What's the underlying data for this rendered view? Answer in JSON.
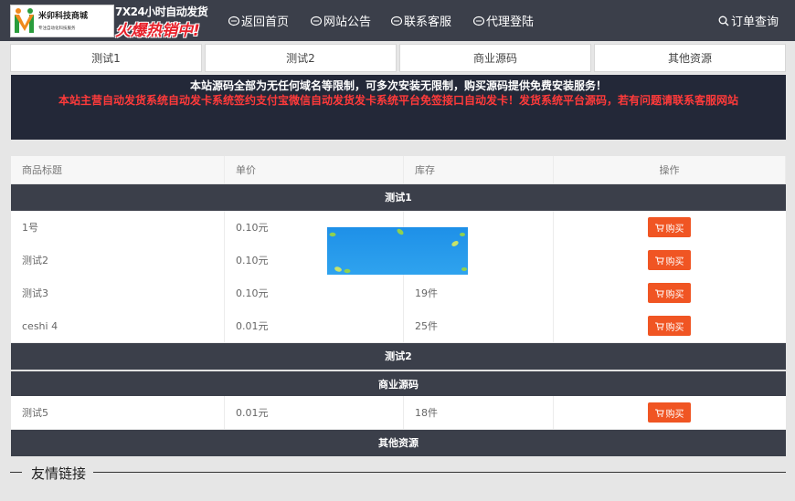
{
  "header": {
    "logo_name": "米卯科技商城",
    "logo_sub": "专注自动化科技服务",
    "promo_line1": "7X24小时自动发货",
    "promo_line2": "火爆热销中!",
    "nav": [
      {
        "label": "返回首页",
        "icon": "home-icon"
      },
      {
        "label": "网站公告",
        "icon": "notice-icon"
      },
      {
        "label": "联系客服",
        "icon": "service-icon"
      },
      {
        "label": "代理登陆",
        "icon": "agent-icon"
      }
    ],
    "order_query": "订单查询"
  },
  "tabs": [
    "测试1",
    "测试2",
    "商业源码",
    "其他资源"
  ],
  "notice": {
    "line1": "本站源码全部为无任何域名等限制，可多次安装无限制，购买源码提供免费安装服务！",
    "line2": "本站主营自动发货系统自动发卡系统签约支付宝微信自动发货发卡系统平台免签接口自动发卡！发货系统平台源码，若有问题请联系客服网站"
  },
  "table": {
    "headers": [
      "商品标题",
      "单价",
      "库存",
      "操作"
    ],
    "categories": [
      {
        "name": "测试1",
        "items": [
          {
            "title": "1号",
            "price": "0.10元",
            "stock": ""
          },
          {
            "title": "测试2",
            "price": "0.10元",
            "stock": ""
          },
          {
            "title": "测试3",
            "price": "0.10元",
            "stock": "19件"
          },
          {
            "title": "ceshi 4",
            "price": "0.01元",
            "stock": "25件"
          }
        ]
      },
      {
        "name": "测试2",
        "items": []
      },
      {
        "name": "商业源码",
        "items": [
          {
            "title": "测试5",
            "price": "0.01元",
            "stock": "18件"
          }
        ]
      },
      {
        "name": "其他资源",
        "items": []
      }
    ],
    "buy_label": "购买"
  },
  "footer": {
    "friend_links_title": "友情链接"
  },
  "colors": {
    "header_bg": "#3b3f4a",
    "notice_bg": "#232838",
    "notice_red": "#ff3a3a",
    "buy_button": "#f05523"
  }
}
